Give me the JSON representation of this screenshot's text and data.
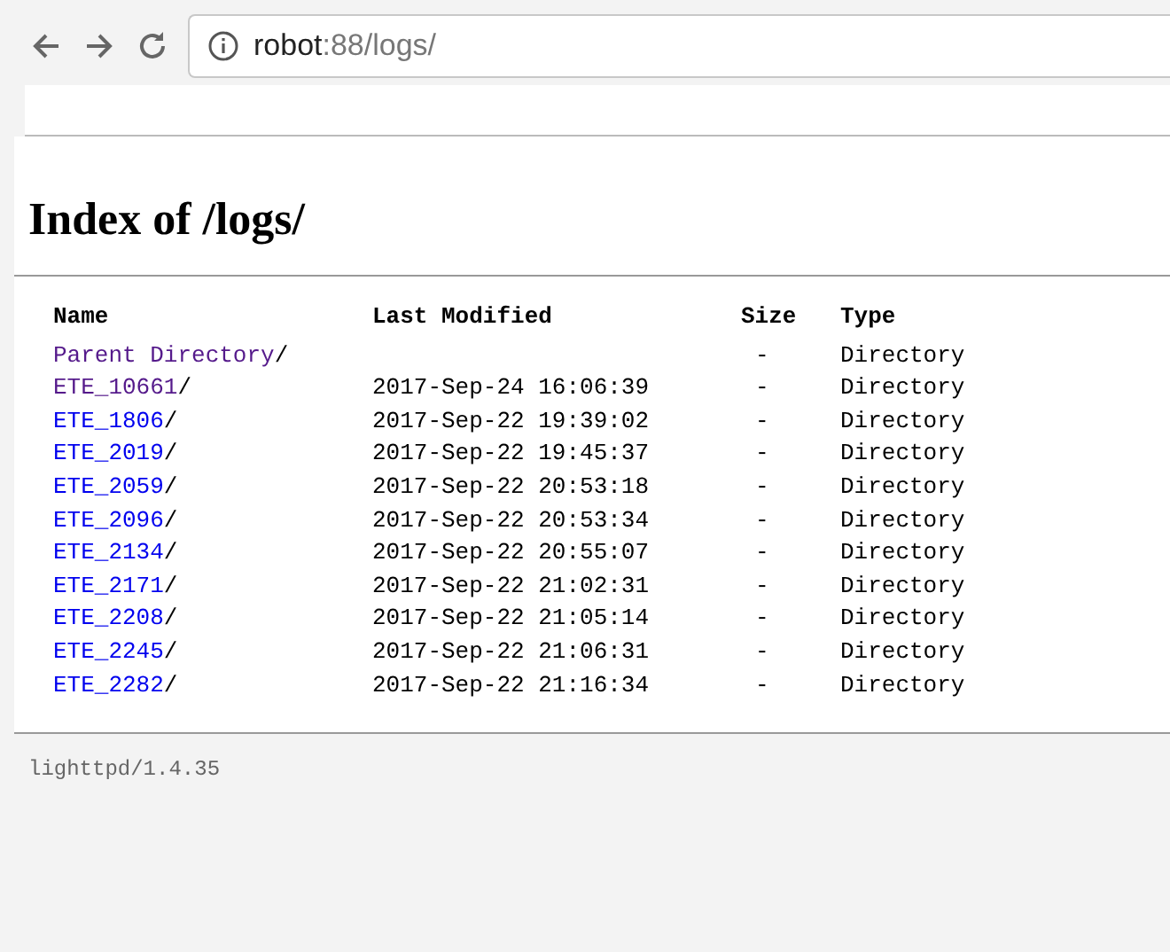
{
  "browser": {
    "host": "robot",
    "path": ":88/logs/"
  },
  "heading": "Index of /logs/",
  "table": {
    "columns": [
      "Name",
      "Last Modified",
      "Size",
      "Type"
    ],
    "rows": [
      {
        "name": "Parent Directory",
        "slash": "/",
        "visited": true,
        "modified": "",
        "size": "-",
        "type": "Directory"
      },
      {
        "name": "ETE_10661",
        "slash": "/",
        "visited": true,
        "modified": "2017-Sep-24 16:06:39",
        "size": "-",
        "type": "Directory"
      },
      {
        "name": "ETE_1806",
        "slash": "/",
        "visited": false,
        "modified": "2017-Sep-22 19:39:02",
        "size": "-",
        "type": "Directory"
      },
      {
        "name": "ETE_2019",
        "slash": "/",
        "visited": false,
        "modified": "2017-Sep-22 19:45:37",
        "size": "-",
        "type": "Directory"
      },
      {
        "name": "ETE_2059",
        "slash": "/",
        "visited": false,
        "modified": "2017-Sep-22 20:53:18",
        "size": "-",
        "type": "Directory"
      },
      {
        "name": "ETE_2096",
        "slash": "/",
        "visited": false,
        "modified": "2017-Sep-22 20:53:34",
        "size": "-",
        "type": "Directory"
      },
      {
        "name": "ETE_2134",
        "slash": "/",
        "visited": false,
        "modified": "2017-Sep-22 20:55:07",
        "size": "-",
        "type": "Directory"
      },
      {
        "name": "ETE_2171",
        "slash": "/",
        "visited": false,
        "modified": "2017-Sep-22 21:02:31",
        "size": "-",
        "type": "Directory"
      },
      {
        "name": "ETE_2208",
        "slash": "/",
        "visited": false,
        "modified": "2017-Sep-22 21:05:14",
        "size": "-",
        "type": "Directory"
      },
      {
        "name": "ETE_2245",
        "slash": "/",
        "visited": false,
        "modified": "2017-Sep-22 21:06:31",
        "size": "-",
        "type": "Directory"
      },
      {
        "name": "ETE_2282",
        "slash": "/",
        "visited": false,
        "modified": "2017-Sep-22 21:16:34",
        "size": "-",
        "type": "Directory"
      }
    ]
  },
  "footer": "lighttpd/1.4.35"
}
